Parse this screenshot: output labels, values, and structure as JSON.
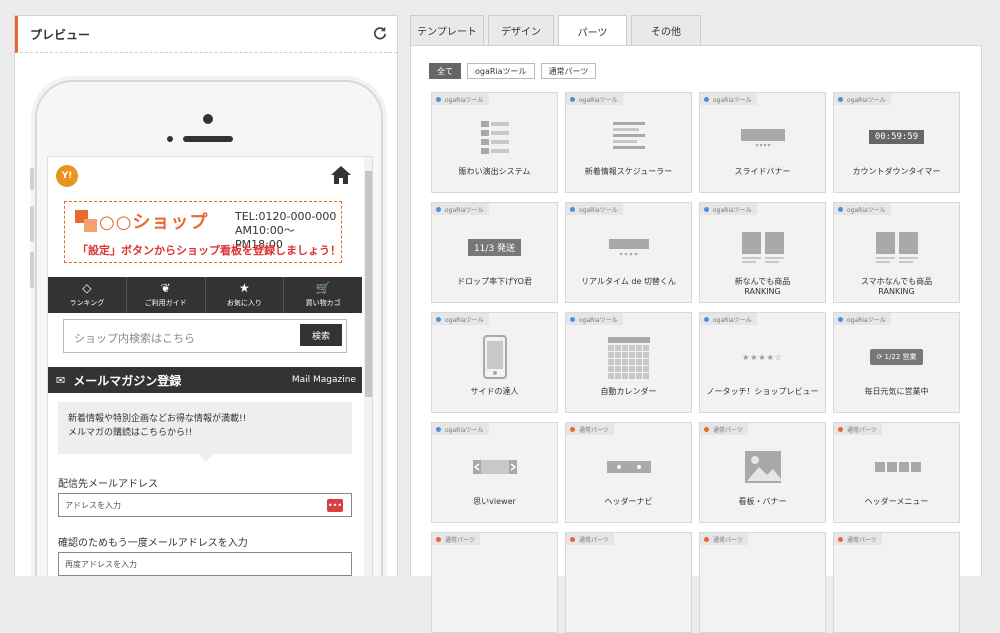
{
  "preview": {
    "title": "プレビュー",
    "shop": {
      "badge": "Y!",
      "name": "○○ショップ",
      "tel": "TEL:0120-000-000",
      "hours": "AM10:00〜PM18:00",
      "notice": "「設定」ボタンからショップ看板を登録しましょう！"
    },
    "nav": [
      {
        "icon": "◇",
        "label": "ランキング"
      },
      {
        "icon": "❦",
        "label": "ご利用ガイド"
      },
      {
        "icon": "★",
        "label": "お気に入り"
      },
      {
        "icon": "🛒",
        "label": "買い物カゴ"
      }
    ],
    "search": {
      "placeholder": "ショップ内検索はこちら",
      "button": "検索"
    },
    "mail": {
      "title": "メールマガジン登録",
      "title_en": "Mail Magazine",
      "desc1": "新着情報や特別企画などお得な情報が満載!!",
      "desc2": "メルマガの購読はこちらから!!",
      "address_label": "配信先メールアドレス",
      "address_placeholder": "アドレスを入力",
      "confirm_label": "確認のためもう一度メールアドレスを入力",
      "confirm_placeholder": "再度アドレスを入力"
    }
  },
  "tabs": [
    "テンプレート",
    "デザイン",
    "パーツ",
    "その他"
  ],
  "active_tab": "パーツ",
  "filters": [
    "全て",
    "ogaRiaツール",
    "通常パーツ"
  ],
  "active_filter": "全て",
  "colors": {
    "accent": "#e8692d",
    "ogaria_dot": "#4a8fe0",
    "normal_dot": "#e8692d"
  },
  "parts": [
    {
      "tag": "ogaRiaツール",
      "kind": "ogaria",
      "icon": "list",
      "label": "賑わい演出システム"
    },
    {
      "tag": "ogaRiaツール",
      "kind": "ogaria",
      "icon": "lines",
      "label": "新着情報スケジューラー"
    },
    {
      "tag": "ogaRiaツール",
      "kind": "ogaria",
      "icon": "slide",
      "label": "スライドバナー"
    },
    {
      "tag": "ogaRiaツール",
      "kind": "ogaria",
      "icon": "countdown",
      "label": "カウントダウンタイマー",
      "text": "00:59:59"
    },
    {
      "tag": "ogaRiaツール",
      "kind": "ogaria",
      "icon": "date",
      "label": "ドロップ率下げYO君",
      "text": "11/3 発送"
    },
    {
      "tag": "ogaRiaツール",
      "kind": "ogaria",
      "icon": "dots",
      "label": "リアルタイム de 切替くん"
    },
    {
      "tag": "ogaRiaツール",
      "kind": "ogaria",
      "icon": "book",
      "label": "新なんでも商品\nRANKING"
    },
    {
      "tag": "ogaRiaツール",
      "kind": "ogaria",
      "icon": "book",
      "label": "スマホなんでも商品\nRANKING"
    },
    {
      "tag": "ogaRiaツール",
      "kind": "ogaria",
      "icon": "phone",
      "label": "サイドの達人"
    },
    {
      "tag": "ogaRiaツール",
      "kind": "ogaria",
      "icon": "calendar",
      "label": "自動カレンダー"
    },
    {
      "tag": "ogaRiaツール",
      "kind": "ogaria",
      "icon": "stars",
      "label": "ノータッチ！ショップレビュー"
    },
    {
      "tag": "ogaRiaツール",
      "kind": "ogaria",
      "icon": "badge",
      "label": "毎日元気に営業中",
      "text": "1/22 営業"
    },
    {
      "tag": "ogaRiaツール",
      "kind": "ogaria",
      "icon": "viewer",
      "label": "思いviewer"
    },
    {
      "tag": "通常パーツ",
      "kind": "normal",
      "icon": "headnav",
      "label": "ヘッダーナビ"
    },
    {
      "tag": "通常パーツ",
      "kind": "normal",
      "icon": "image",
      "label": "看板・バナー"
    },
    {
      "tag": "通常パーツ",
      "kind": "normal",
      "icon": "menu",
      "label": "ヘッダーメニュー"
    },
    {
      "tag": "通常パーツ",
      "kind": "normal",
      "icon": "blank",
      "label": ""
    },
    {
      "tag": "通常パーツ",
      "kind": "normal",
      "icon": "blank",
      "label": ""
    },
    {
      "tag": "通常パーツ",
      "kind": "normal",
      "icon": "blank",
      "label": ""
    },
    {
      "tag": "通常パーツ",
      "kind": "normal",
      "icon": "blank",
      "label": ""
    }
  ]
}
